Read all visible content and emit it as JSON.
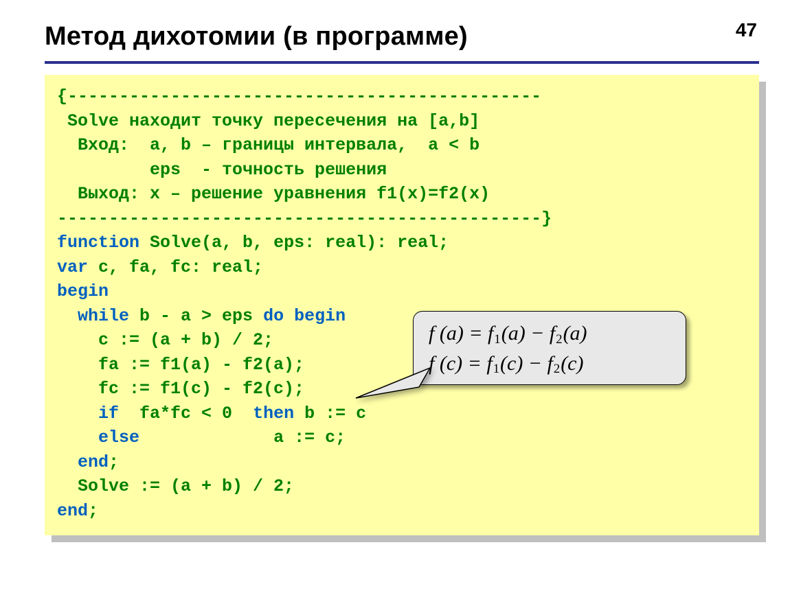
{
  "page_number": "47",
  "title": "Метод дихотомии (в программе)",
  "code": {
    "l1": "{----------------------------------------------",
    "l2": " Solve находит точку пересечения на [a,b]",
    "l3": "  Вход:  a, b – границы интервала,  a < b",
    "l4": "         eps  - точность решения",
    "l5": "  Выход: x – решение уравнения f1(x)=f2(x)",
    "l6": "-----------------------------------------------}",
    "l7a": "function",
    "l7b": " Solve(a, b, eps: real): real;",
    "l8a": "var",
    "l8b": " c, fa, fc: real;",
    "l9": "begin",
    "l10a": "  while",
    "l10b": " b - a > eps ",
    "l10c": "do begin",
    "l11": "    c := (a + b) / 2;",
    "l12": "    fa := f1(a) - f2(a);",
    "l13": "    fc := f1(c) - f2(c);",
    "l14a": "    if",
    "l14b": "  fa*fc < 0  ",
    "l14c": "then",
    "l14d": " b := c",
    "l15a": "    else",
    "l15b": "             a := c;",
    "l16": "  end",
    "l16b": ";",
    "l17": "  Solve := (a + b) / 2;",
    "l18": "end",
    "l18b": ";"
  },
  "callout": {
    "line1": {
      "pre": "f (a) = f",
      "s1": "1",
      "mid": "(a) − f",
      "s2": "2",
      "post": "(a)"
    },
    "line2": {
      "pre": "f (c) = f",
      "s1": "1",
      "mid": "(c) − f",
      "s2": "2",
      "post": "(c)"
    }
  }
}
